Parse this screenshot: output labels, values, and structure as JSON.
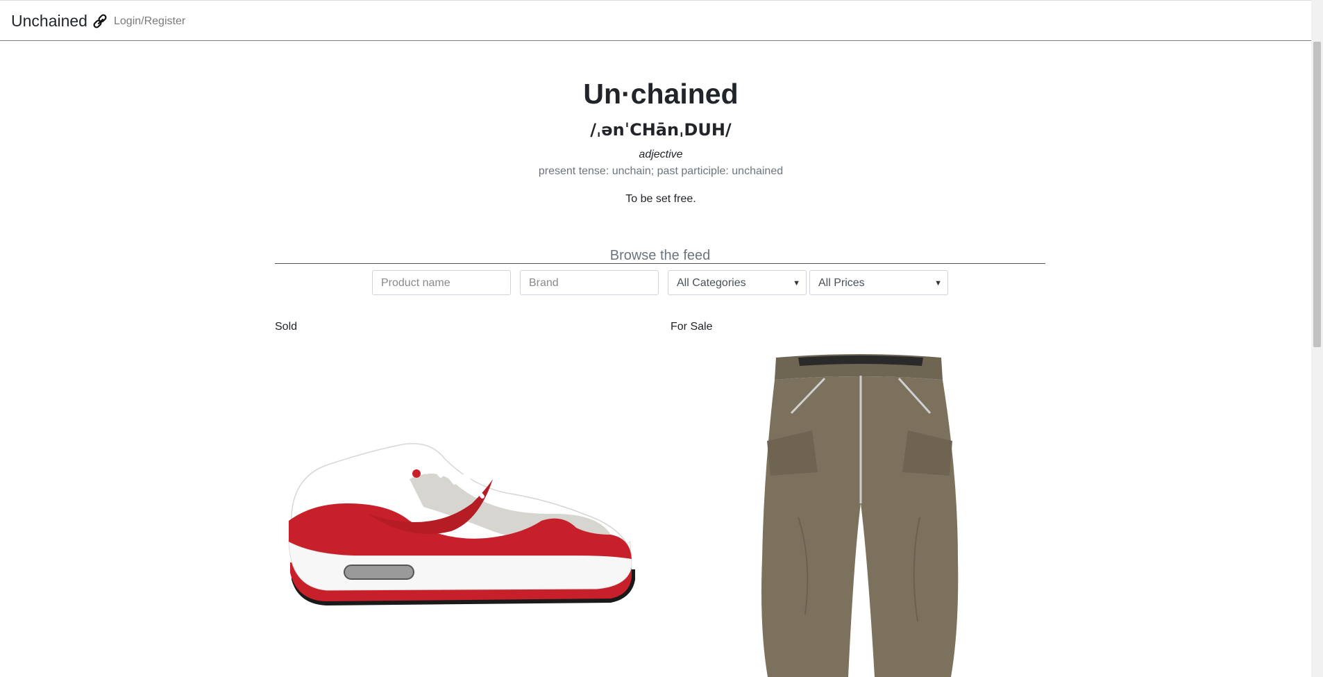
{
  "navbar": {
    "brand": "Unchained",
    "brand_icon": "link-icon",
    "login_link": "Login/Register"
  },
  "hero": {
    "word": "Un·chained",
    "pronunciation": "/ˌənˈCHānˌDUH/",
    "part_of_speech": "adjective",
    "tenses": "present tense: unchain; past participle: unchained",
    "definition": "To be set free."
  },
  "browse": {
    "title": "Browse the feed",
    "filters": {
      "product_name_placeholder": "Product name",
      "brand_placeholder": "Brand",
      "category_selected": "All Categories",
      "price_selected": "All Prices"
    }
  },
  "products": [
    {
      "status": "Sold",
      "image": "red-white-sneaker-image"
    },
    {
      "status": "For Sale",
      "image": "olive-cargo-pants-image"
    }
  ],
  "colors": {
    "text": "#212529",
    "muted": "#6c757d",
    "shoe_red": "#c8202a",
    "pants_olive": "#7c715c"
  }
}
